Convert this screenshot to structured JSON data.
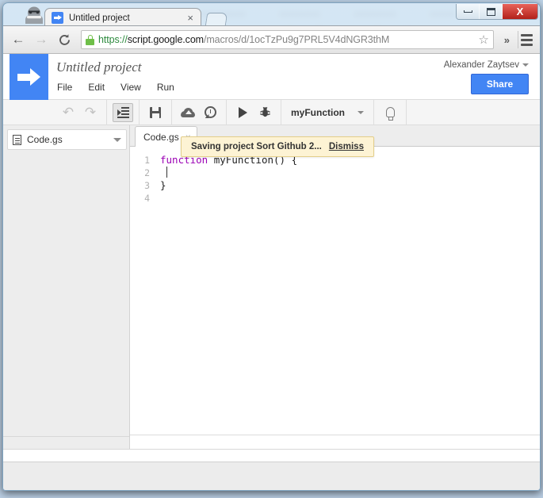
{
  "window": {
    "minimize_label": "Minimize",
    "maximize_label": "Maximize",
    "close_label": "X"
  },
  "browser": {
    "tab": {
      "title": "Untitled project",
      "close_label": "×",
      "favicon_name": "apps-script-favicon"
    },
    "newtab_label": "",
    "back_label": "←",
    "forward_label": "→",
    "reload_label": "C",
    "url": {
      "scheme": "https://",
      "host": "script.google.com",
      "path": "/macros/d/1ocTzPu9g7PRL5V4dNGR3thM"
    },
    "star_label": "☆",
    "overflow_label": "»"
  },
  "app": {
    "project_title": "Untitled project",
    "menus": [
      {
        "label": "File"
      },
      {
        "label": "Edit"
      },
      {
        "label": "View"
      },
      {
        "label": "Run"
      }
    ],
    "notification": {
      "message": "Saving project Sort Github 2...",
      "dismiss_label": "Dismiss"
    },
    "user": {
      "name": "Alexander Zaytsev"
    },
    "share_label": "Share",
    "toolbar": {
      "undo_label": "↶",
      "redo_label": "↷",
      "indent_name": "indent-code-icon",
      "save_name": "save-icon",
      "deploy_name": "cloud-upload-icon",
      "history_name": "version-history-icon",
      "run_name": "run-icon",
      "debug_label": "🐞",
      "function_selected": "myFunction",
      "bulb_name": "lightbulb-icon"
    },
    "sidebar": {
      "files": [
        {
          "name": "Code.gs"
        }
      ]
    },
    "editor": {
      "tabs": [
        {
          "label": "Code.gs",
          "close_label": "×"
        }
      ],
      "line_numbers": [
        "1",
        "2",
        "3",
        "4"
      ],
      "code": {
        "line1_keyword": "function",
        "line1_rest": " myFunction() {",
        "line2": "",
        "line3": "}",
        "line4": ""
      }
    }
  },
  "colors": {
    "brand_blue": "#4285f4",
    "keyword_purple": "#9b00b5",
    "notification_bg": "#fdf3d4",
    "notification_border": "#e3ce8a"
  }
}
